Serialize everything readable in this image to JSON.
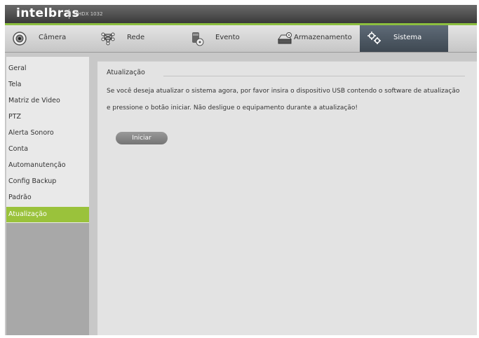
{
  "header": {
    "brand": "intelbras",
    "model": "MHDX 1032"
  },
  "tabs": [
    {
      "label": "Câmera",
      "icon": "camera-icon"
    },
    {
      "label": "Rede",
      "icon": "network-icon"
    },
    {
      "label": "Evento",
      "icon": "event-icon"
    },
    {
      "label": "Armazenamento",
      "icon": "storage-icon"
    },
    {
      "label": "Sistema",
      "icon": "gears-icon",
      "active": true
    }
  ],
  "sidebar": {
    "items": [
      {
        "label": "Geral"
      },
      {
        "label": "Tela"
      },
      {
        "label": "Matriz de Video"
      },
      {
        "label": "PTZ"
      },
      {
        "label": "Alerta Sonoro"
      },
      {
        "label": "Conta"
      },
      {
        "label": "Automanutenção"
      },
      {
        "label": "Config Backup"
      },
      {
        "label": "Padrão"
      },
      {
        "label": "Atualização",
        "active": true
      }
    ]
  },
  "main": {
    "section_title": "Atualização",
    "message_line1": "Se você deseja atualizar o sistema agora, por favor insira o dispositivo USB contendo o software de atualização",
    "message_line2": "e pressione o botão iniciar. Não desligue o equipamento durante a atualização!",
    "start_button": "Iniciar"
  },
  "colors": {
    "accent_green": "#9ac23b",
    "active_tab": "#4a5560"
  }
}
